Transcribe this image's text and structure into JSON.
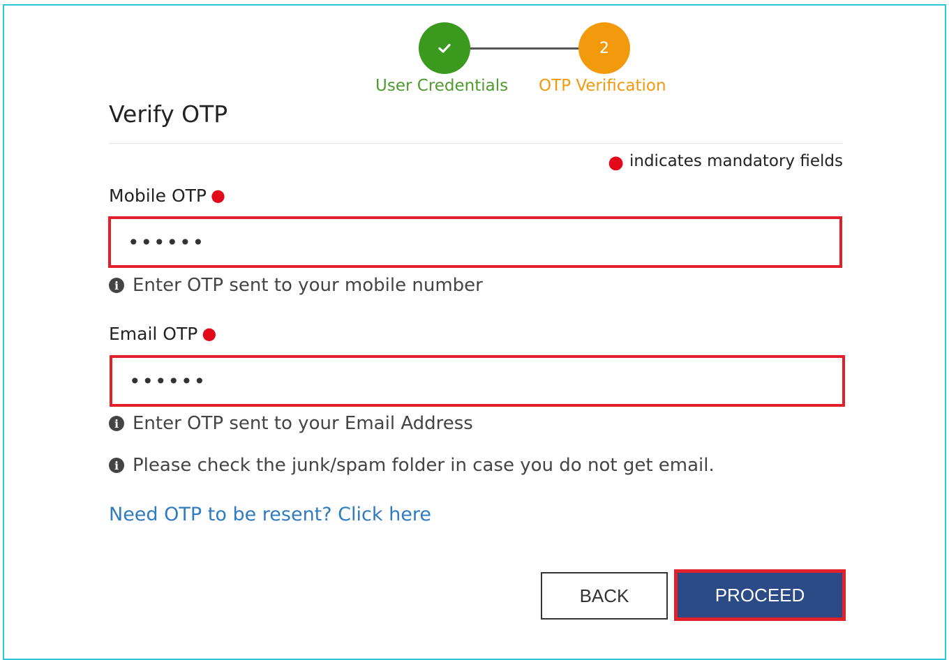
{
  "stepper": {
    "steps": [
      {
        "label": "User Credentials",
        "state": "completed",
        "icon": "check-icon",
        "color": "#3a9a1e"
      },
      {
        "label": "OTP Verification",
        "state": "active",
        "number": "2",
        "color": "#f29a0c"
      }
    ]
  },
  "form": {
    "title": "Verify OTP",
    "mandatory_note": "indicates mandatory fields",
    "mobile_otp": {
      "label": "Mobile OTP",
      "value": "••••••",
      "hint": "Enter OTP sent to your mobile number"
    },
    "email_otp": {
      "label": "Email OTP",
      "value": "••••••",
      "hint": "Enter OTP sent to your Email Address"
    },
    "spam_hint": "Please check the junk/spam folder in case you do not get email.",
    "resend_link": "Need OTP to be resent? Click here",
    "back_label": "BACK",
    "proceed_label": "PROCEED"
  },
  "colors": {
    "highlight": "#e2202a",
    "primary": "#2b4a86",
    "link": "#2f7bbf",
    "frame": "#2ec4d6"
  }
}
